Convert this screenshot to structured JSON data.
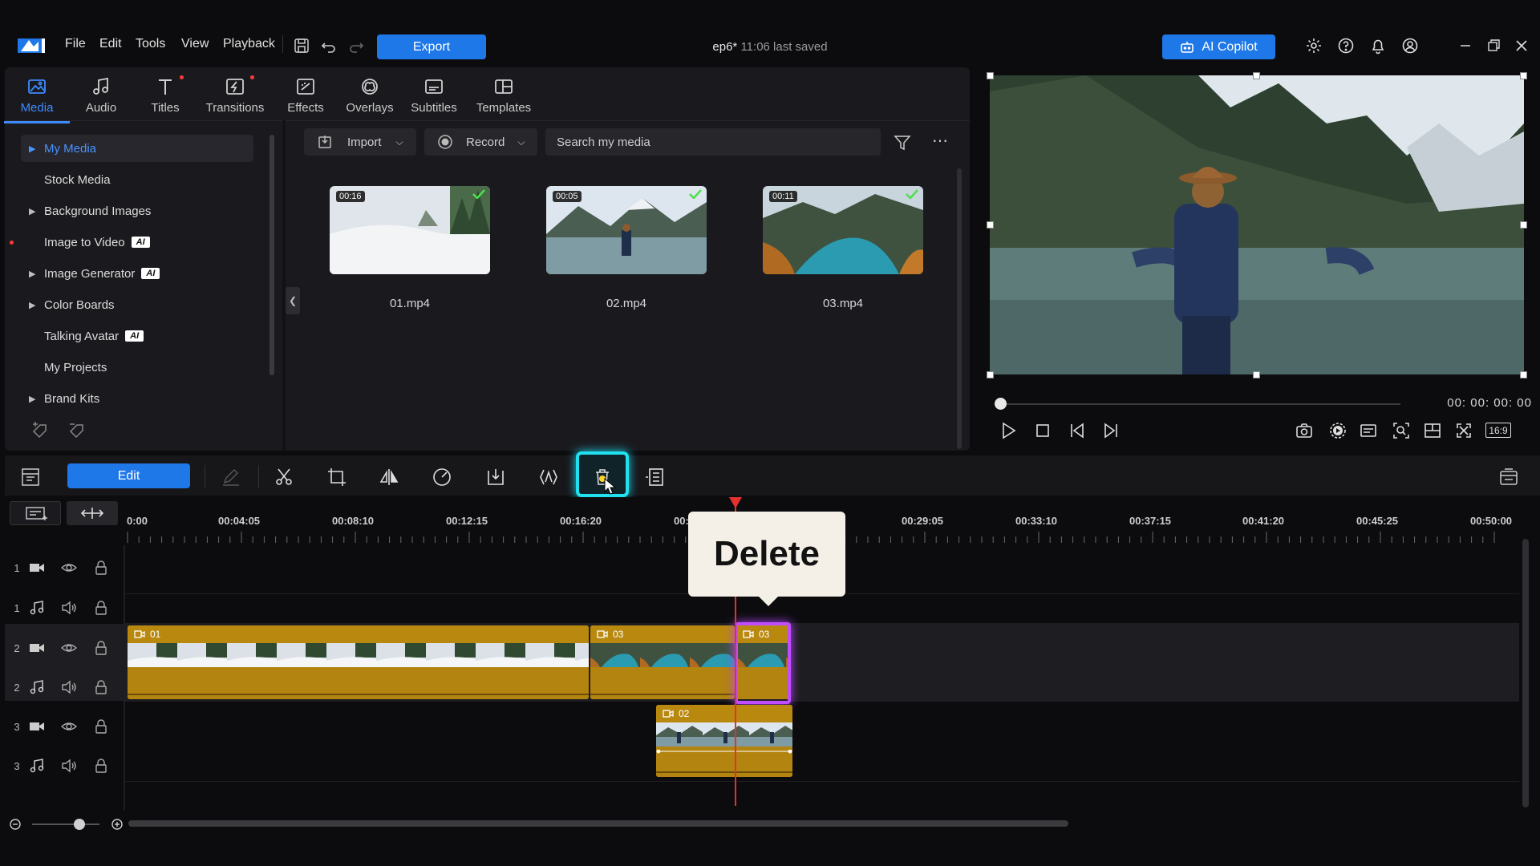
{
  "menu": {
    "file": "File",
    "edit": "Edit",
    "tools": "Tools",
    "view": "View",
    "playback": "Playback"
  },
  "export_label": "Export",
  "project": {
    "name": "ep6*",
    "status": "11:06 last saved"
  },
  "copilot_label": "AI Copilot",
  "room_tabs": [
    {
      "label": "Media",
      "icon": "media-icon",
      "active": true
    },
    {
      "label": "Audio",
      "icon": "music-note-icon"
    },
    {
      "label": "Titles",
      "icon": "titles-icon",
      "dot": true
    },
    {
      "label": "Transitions",
      "icon": "transitions-icon",
      "dot": true
    },
    {
      "label": "Effects",
      "icon": "effects-icon"
    },
    {
      "label": "Overlays",
      "icon": "overlays-icon"
    },
    {
      "label": "Subtitles",
      "icon": "subtitles-icon"
    },
    {
      "label": "Templates",
      "icon": "templates-icon"
    }
  ],
  "library_tree": [
    {
      "label": "My Media",
      "arrow": true,
      "selected": true
    },
    {
      "label": "Stock Media"
    },
    {
      "label": "Background Images",
      "arrow": true
    },
    {
      "label": "Image to Video",
      "ai": "AI"
    },
    {
      "label": "Image Generator",
      "arrow": true,
      "ai": "AI"
    },
    {
      "label": "Color Boards",
      "arrow": true
    },
    {
      "label": "Talking Avatar",
      "ai": "AI"
    },
    {
      "label": "My Projects"
    },
    {
      "label": "Brand Kits",
      "arrow": true
    }
  ],
  "media_toolbar": {
    "import_label": "Import",
    "record_label": "Record",
    "search_placeholder": "Search my media"
  },
  "media_items": [
    {
      "name": "01.mp4",
      "duration": "00:16"
    },
    {
      "name": "02.mp4",
      "duration": "00:05"
    },
    {
      "name": "03.mp4",
      "duration": "00:11"
    }
  ],
  "preview": {
    "timecode": "00: 00: 00: 00",
    "aspect": "16:9"
  },
  "edit_label": "Edit",
  "tooltip": "Delete",
  "ruler_labels": [
    "0:00",
    "00:04:05",
    "00:08:10",
    "00:12:15",
    "00:16:20",
    "00:",
    "00:29:05",
    "00:33:10",
    "00:37:15",
    "00:41:20",
    "00:45:25",
    "00:50:00"
  ],
  "tracks": [
    {
      "num": "1",
      "type": "video"
    },
    {
      "num": "1",
      "type": "audio"
    },
    {
      "num": "2",
      "type": "video"
    },
    {
      "num": "2",
      "type": "audio"
    },
    {
      "num": "3",
      "type": "video"
    },
    {
      "num": "3",
      "type": "audio"
    }
  ],
  "clips": {
    "c1": "01",
    "c2": "03",
    "c3": "03",
    "c4": "02"
  },
  "colors": {
    "accent": "#1f78e8",
    "clip": "#b9890f",
    "selection": "#c04dff",
    "highlight": "#21e0f0",
    "playhead": "#e53030"
  }
}
